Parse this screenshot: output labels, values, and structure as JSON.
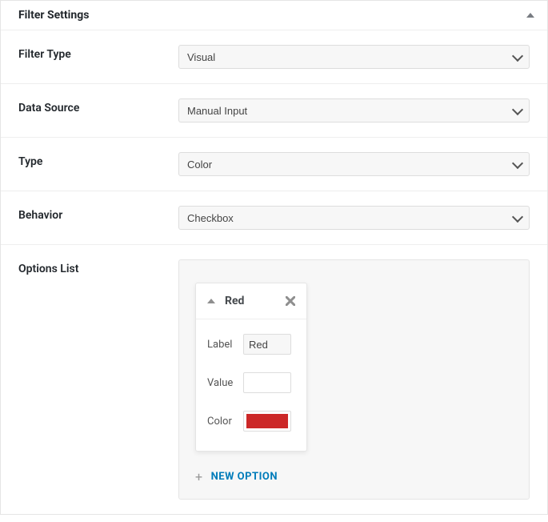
{
  "panel": {
    "title": "Filter Settings"
  },
  "fields": {
    "filter_type": {
      "label": "Filter Type",
      "value": "Visual"
    },
    "data_source": {
      "label": "Data Source",
      "value": "Manual Input"
    },
    "type": {
      "label": "Type",
      "value": "Color"
    },
    "behavior": {
      "label": "Behavior",
      "value": "Checkbox"
    },
    "options_list": {
      "label": "Options List"
    }
  },
  "option": {
    "title": "Red",
    "label_field": "Label",
    "label_value": "Red",
    "value_field": "Value",
    "value_value": "",
    "color_field": "Color",
    "color_value": "#cc2828"
  },
  "new_option_label": "NEW OPTION"
}
